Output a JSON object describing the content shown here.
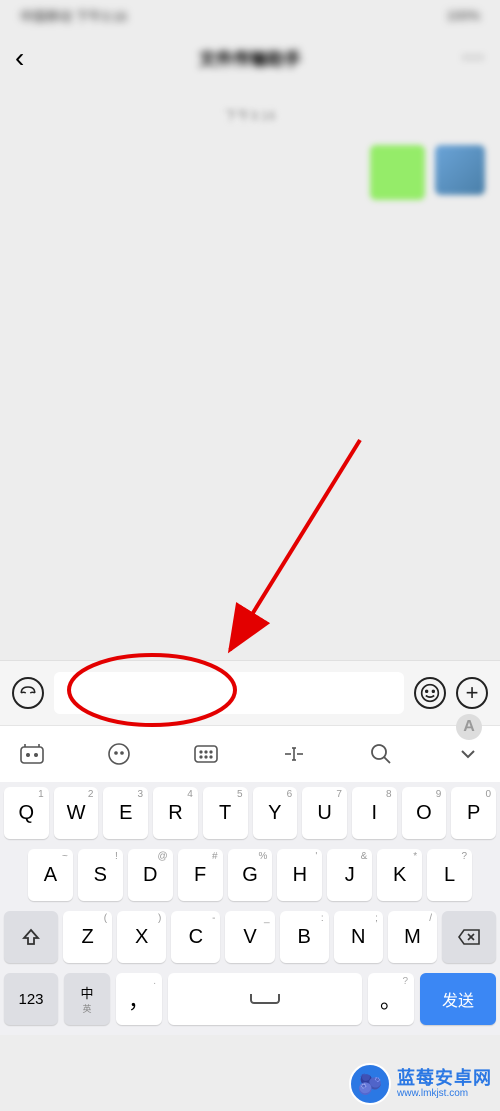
{
  "status": {
    "left": "中国移动 下午3:16",
    "right": "100%"
  },
  "nav": {
    "title": "文件传输助手",
    "menu": "···"
  },
  "chat": {
    "date": "下午3:16"
  },
  "input": {
    "placeholder": ""
  },
  "keyboard": {
    "row1": [
      {
        "main": "Q",
        "hint": "1"
      },
      {
        "main": "W",
        "hint": "2"
      },
      {
        "main": "E",
        "hint": "3"
      },
      {
        "main": "R",
        "hint": "4"
      },
      {
        "main": "T",
        "hint": "5"
      },
      {
        "main": "Y",
        "hint": "6"
      },
      {
        "main": "U",
        "hint": "7"
      },
      {
        "main": "I",
        "hint": "8"
      },
      {
        "main": "O",
        "hint": "9"
      },
      {
        "main": "P",
        "hint": "0"
      }
    ],
    "row2": [
      {
        "main": "A",
        "hint": "~"
      },
      {
        "main": "S",
        "hint": "!"
      },
      {
        "main": "D",
        "hint": "@"
      },
      {
        "main": "F",
        "hint": "#"
      },
      {
        "main": "G",
        "hint": "%"
      },
      {
        "main": "H",
        "hint": "'"
      },
      {
        "main": "J",
        "hint": "&"
      },
      {
        "main": "K",
        "hint": "*"
      },
      {
        "main": "L",
        "hint": "?"
      }
    ],
    "row3": [
      {
        "main": "Z",
        "hint": "("
      },
      {
        "main": "X",
        "hint": ")"
      },
      {
        "main": "C",
        "hint": "-"
      },
      {
        "main": "V",
        "hint": "_"
      },
      {
        "main": "B",
        "hint": ":"
      },
      {
        "main": "N",
        "hint": ";"
      },
      {
        "main": "M",
        "hint": "/"
      }
    ],
    "fn": {
      "num": "123",
      "lang_main": "中",
      "lang_sub": "英",
      "comma": "，",
      "comma_hint": ".",
      "period": "。",
      "period_hint": "?",
      "send": "发送"
    }
  },
  "watermark": {
    "title": "蓝莓安卓网",
    "url": "www.lmkjst.com",
    "emoji": "🫐"
  }
}
